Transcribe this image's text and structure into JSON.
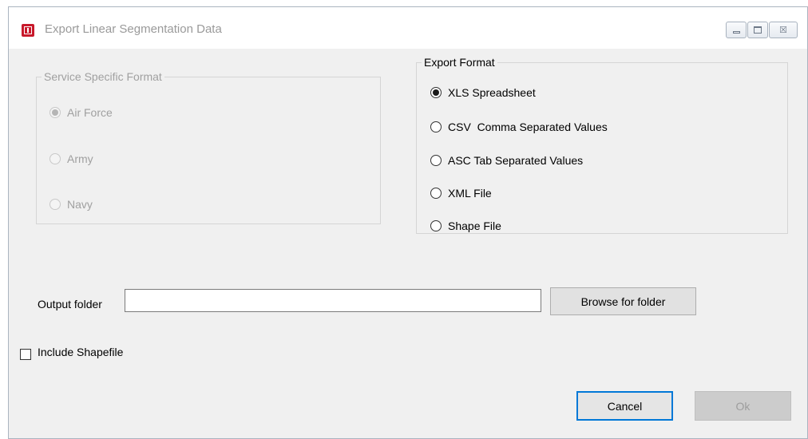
{
  "window": {
    "title": "Export Linear Segmentation Data",
    "icon": "app-icon",
    "controls": [
      "minimize-icon",
      "maximize-icon",
      "close-icon"
    ],
    "close_glyph": "☒"
  },
  "service_group": {
    "legend": "Service Specific Format",
    "enabled": false,
    "options": [
      {
        "label": "Air Force",
        "checked": true
      },
      {
        "label": "Army",
        "checked": false
      },
      {
        "label": "Navy",
        "checked": false
      }
    ]
  },
  "export_group": {
    "legend": "Export Format",
    "options": [
      {
        "label": "XLS Spreadsheet",
        "checked": true
      },
      {
        "label": "CSV  Comma Separated Values",
        "checked": false
      },
      {
        "label": "ASC Tab Separated Values",
        "checked": false
      },
      {
        "label": "XML File",
        "checked": false
      },
      {
        "label": "Shape File",
        "checked": false
      }
    ]
  },
  "output": {
    "label": "Output folder",
    "value": "",
    "browse_label": "Browse for folder"
  },
  "include_shapefile": {
    "label": "Include Shapefile",
    "checked": false
  },
  "buttons": {
    "cancel": "Cancel",
    "ok": "Ok"
  },
  "colors": {
    "accent": "#0078d7",
    "icon_red": "#c8192b",
    "disabled_text": "#a0a0a0"
  }
}
